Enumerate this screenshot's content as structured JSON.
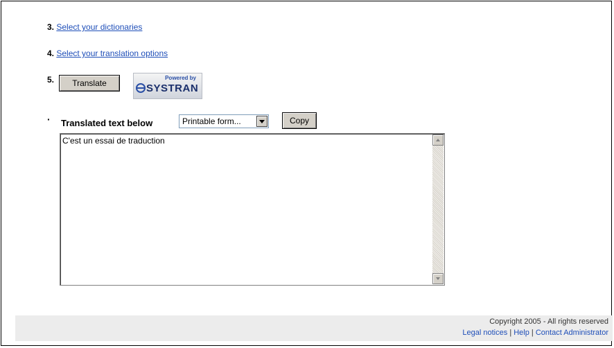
{
  "steps": {
    "step3": {
      "number": "3.",
      "link": "Select your dictionaries"
    },
    "step4": {
      "number": "4.",
      "link": "Select your translation options"
    },
    "step5": {
      "number": "5.",
      "button": "Translate"
    }
  },
  "logo": {
    "powered_by": "Powered by",
    "brand": "SYSTRAN"
  },
  "output": {
    "bullet": "·",
    "label": "Translated text below",
    "format_select": "Printable form...",
    "copy_button": "Copy",
    "translated_text": "C'est un essai de traduction"
  },
  "footer": {
    "copyright": "Copyright 2005 - All rights reserved",
    "links": [
      "Legal notices",
      "Help",
      "Contact Administrator"
    ],
    "separator": "|"
  },
  "colors": {
    "link": "#1e4eb8",
    "footer_bg": "#ececec",
    "button_face": "#d4d0c8"
  },
  "icons": {
    "dropdown": "triangle-down",
    "scroll_up": "triangle-up",
    "scroll_down": "triangle-down"
  }
}
